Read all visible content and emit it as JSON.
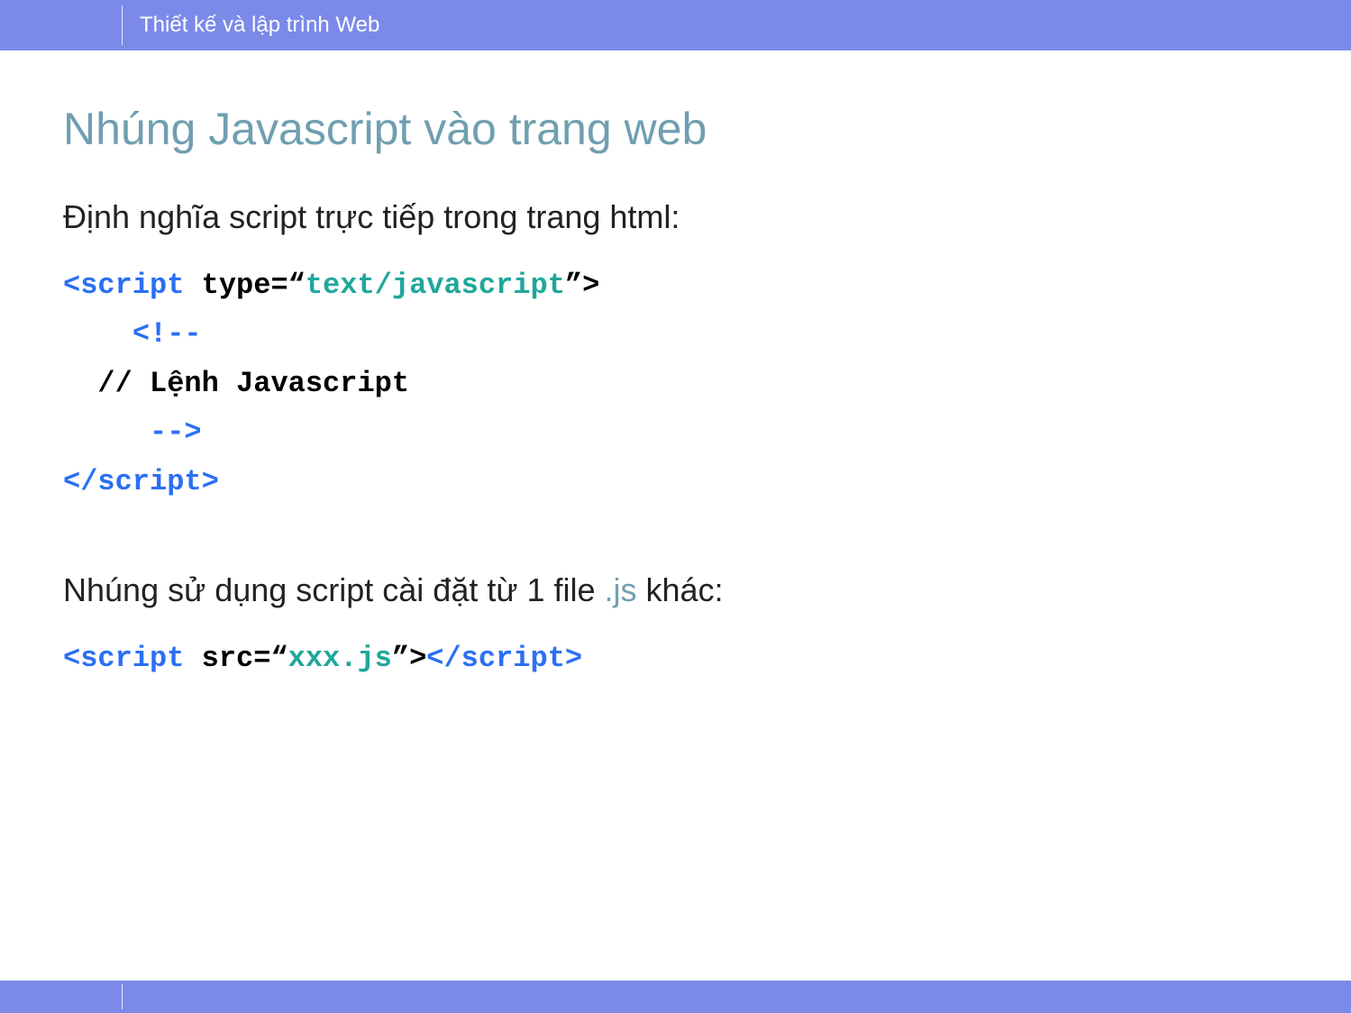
{
  "header": {
    "course_name": "Thiết kế và lập trình Web"
  },
  "slide": {
    "title": "Nhúng Javascript vào trang web",
    "section1": {
      "heading": "Định nghĩa script trực tiếp trong trang html:",
      "code": {
        "line1_open": "<script ",
        "line1_attr": "type=“",
        "line1_val": "text/javascript",
        "line1_close_attr": "”>",
        "line2": "    <!--",
        "line3": "  // Lệnh Javascript",
        "line4": "     -->",
        "line5": "</script>"
      }
    },
    "section2": {
      "heading_part1": "Nhúng sử dụng script cài đặt từ 1 file ",
      "heading_js": ".js",
      "heading_part2": " khác:",
      "code": {
        "open": "<script ",
        "attr": "src=“",
        "val": "xxx.js",
        "close_attr": "”>",
        "end": "</script>"
      }
    }
  }
}
